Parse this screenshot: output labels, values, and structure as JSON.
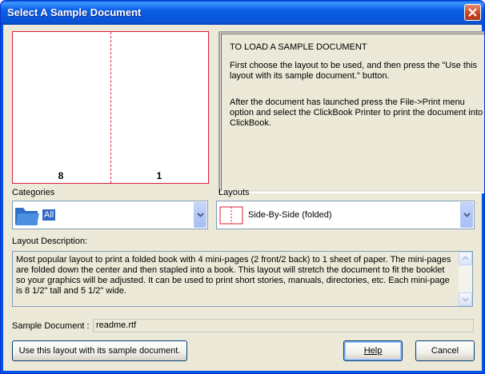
{
  "window": {
    "title": "Select A Sample Document"
  },
  "preview": {
    "left_page": "8",
    "right_page": "1"
  },
  "info": {
    "heading": "TO LOAD A SAMPLE DOCUMENT",
    "para1": "First choose the layout to be used, and then press the \"Use this layout with its sample document.\" button.",
    "para2": "After the document has launched press the File->Print menu option and select the ClickBook Printer to print the document into ClickBook."
  },
  "categories": {
    "label": "Categories",
    "selected": "All"
  },
  "layouts": {
    "label": "Layouts",
    "selected": "Side-By-Side (folded)"
  },
  "description": {
    "label": "Layout Description:",
    "text": "Most popular layout to print a folded book with 4 mini-pages (2 front/2 back) to 1 sheet of paper. The mini-pages are folded down the center and then stapled into a book.  This layout will stretch the document to fit the booklet so your graphics will be adjusted.  It can be used to print short stories, manuals, directories, etc.  Each mini-page is 8 1/2\" tall and 5 1/2\" wide."
  },
  "sample": {
    "label": "Sample Document :",
    "value": "readme.rtf"
  },
  "buttons": {
    "use_layout": "Use this layout with its sample document.",
    "help": "Help",
    "cancel": "Cancel"
  }
}
